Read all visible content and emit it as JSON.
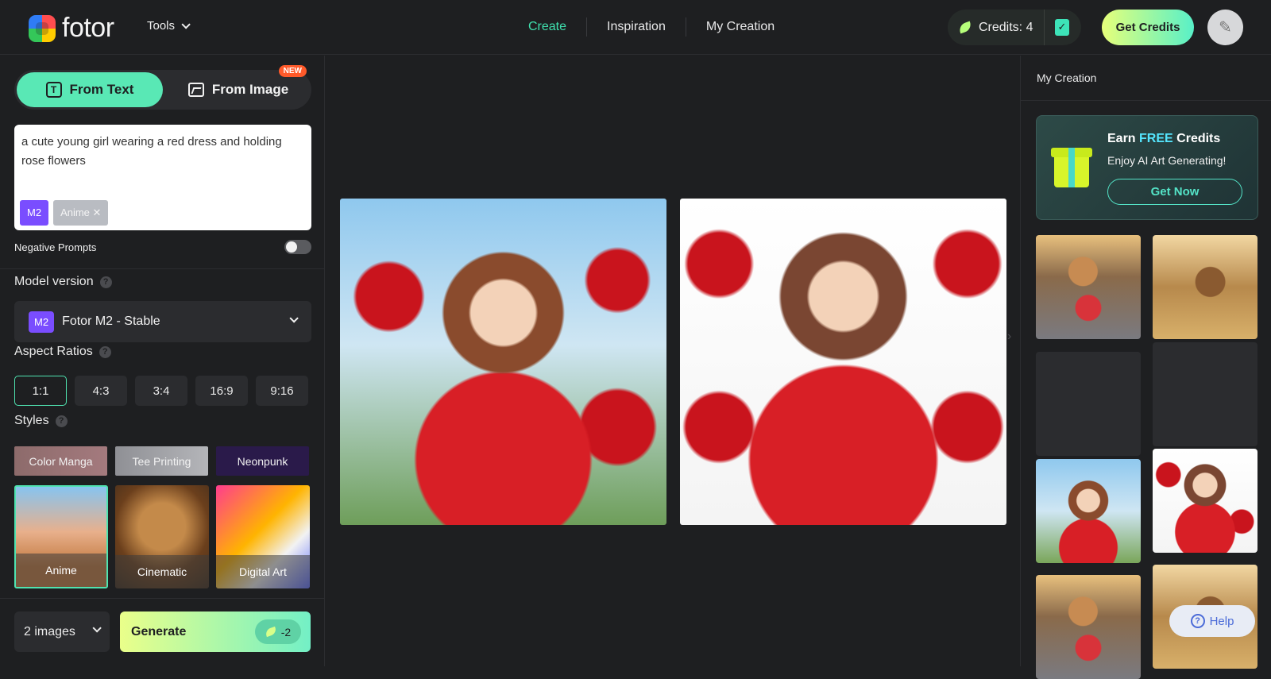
{
  "header": {
    "logo_text": "fotor",
    "tools_label": "Tools",
    "nav": [
      "Create",
      "Inspiration",
      "My Creation"
    ],
    "credits_label": "Credits: 4",
    "get_credits_label": "Get Credits"
  },
  "left": {
    "mode_from_text": "From Text",
    "mode_from_image": "From Image",
    "new_badge": "NEW",
    "prompt_text": "a cute young girl wearing a red dress and holding rose flowers",
    "tag_model": "M2",
    "tag_style": "Anime",
    "negative_prompts_label": "Negative Prompts",
    "model_version_label": "Model version",
    "model_badge": "M2",
    "model_value": "Fotor M2 - Stable",
    "aspect_label": "Aspect Ratios",
    "ratios": [
      "1:1",
      "4:3",
      "3:4",
      "16:9",
      "9:16"
    ],
    "styles_label": "Styles",
    "style_chips": [
      "Color Manga",
      "Tee Printing",
      "Neonpunk"
    ],
    "style_cards": [
      "Anime",
      "Cinematic",
      "Digital Art"
    ],
    "count_value": "2 images",
    "generate_label": "Generate",
    "cost_value": "-2"
  },
  "right": {
    "title": "My Creation",
    "promo_earn": "Earn",
    "promo_free": "FREE",
    "promo_credits": "Credits",
    "promo_sub": "Enjoy AI Art Generating!",
    "get_now_label": "Get Now",
    "help_label": "Help"
  },
  "colors": {
    "accent": "#3fe0ae",
    "model_badge": "#7a4dff",
    "new_badge": "#ff5a2a"
  }
}
